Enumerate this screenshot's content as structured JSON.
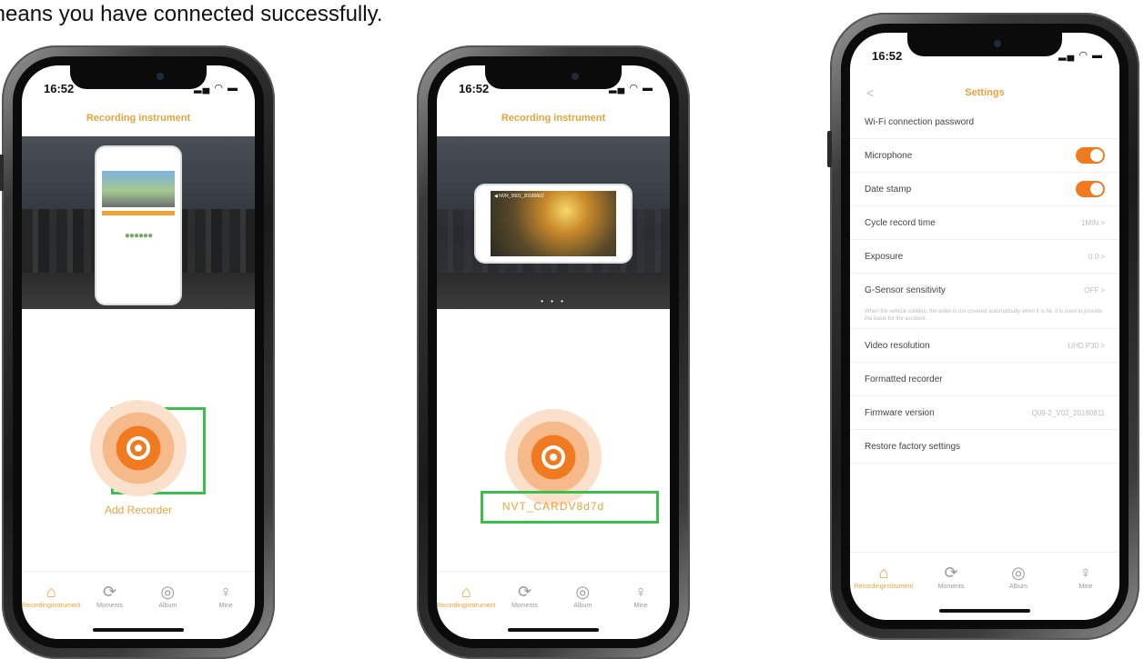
{
  "caption": "means you have connected successfully.",
  "status": {
    "time": "16:52",
    "icons": "▂▄ ◠ ▬"
  },
  "tabs": [
    {
      "label": "Recordinginstrument",
      "icon": "dashcam-icon",
      "glyph": "⌂"
    },
    {
      "label": "Moments",
      "icon": "sync-icon",
      "glyph": "⟳"
    },
    {
      "label": "Album",
      "icon": "album-icon",
      "glyph": "◎"
    },
    {
      "label": "Mine",
      "icon": "person-icon",
      "glyph": "♀"
    }
  ],
  "phone1": {
    "app_title": "Recording instrument",
    "add_label": "Add Recorder",
    "dots": "• • •"
  },
  "phone2": {
    "app_title": "Recording instrument",
    "ssid": "NVT_CARDV8d7d",
    "dots": "• • •"
  },
  "phone3": {
    "header": "Settings",
    "back": "<",
    "rows": [
      {
        "label": "Wi-Fi connection password",
        "value": ""
      },
      {
        "label": "Microphone",
        "toggle": true
      },
      {
        "label": "Date stamp",
        "toggle": true
      },
      {
        "label": "Cycle record time",
        "value": "1MIN >"
      },
      {
        "label": "Exposure",
        "value": "0.0 >"
      },
      {
        "label": "G-Sensor sensitivity",
        "value": "OFF >"
      },
      {
        "label": "Video resolution",
        "value": "UHD P30 >"
      },
      {
        "label": "Formatted recorder",
        "value": ""
      },
      {
        "label": "Firmware version",
        "value": "Q09-2_V02_20180811"
      },
      {
        "label": "Restore factory settings",
        "value": ""
      }
    ],
    "gsensor_note": "When the vehicle collides, the video is not covered automatically when it is hit, it is used to provide the basis for the accident."
  },
  "colors": {
    "accent": "#e8a23a",
    "highlight": "#3ac04a",
    "toggle": "#f07a20"
  }
}
